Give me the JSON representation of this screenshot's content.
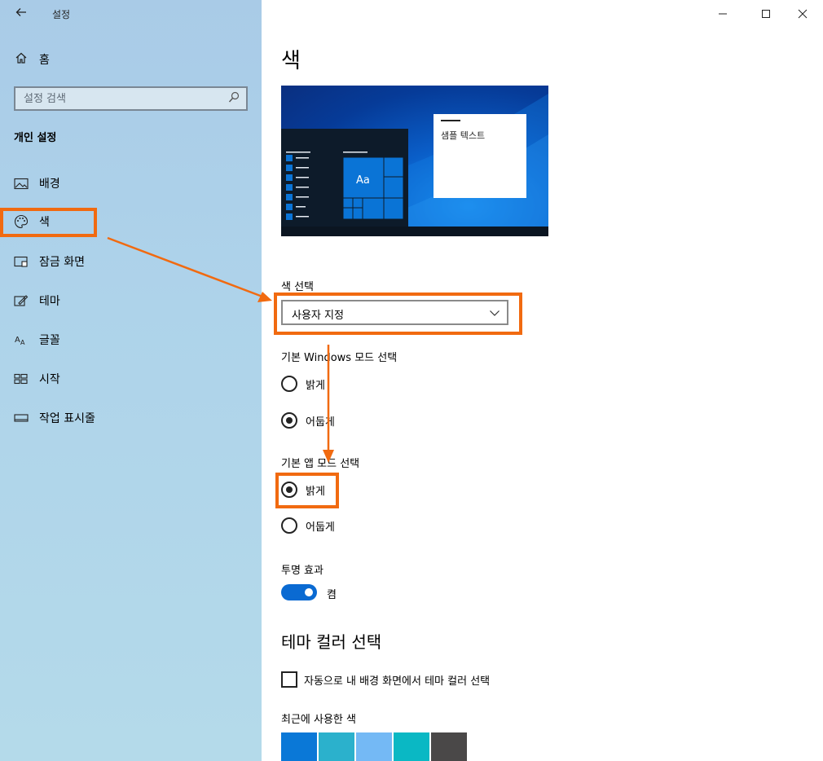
{
  "window": {
    "title": "설정"
  },
  "sidebar": {
    "home_label": "홈",
    "search_placeholder": "설정 검색",
    "section_heading": "개인 설정",
    "items": [
      {
        "label": "배경",
        "icon": "image-icon"
      },
      {
        "label": "색",
        "icon": "palette-icon"
      },
      {
        "label": "잠금 화면",
        "icon": "lock-screen-icon"
      },
      {
        "label": "테마",
        "icon": "theme-icon"
      },
      {
        "label": "글꼴",
        "icon": "font-icon"
      },
      {
        "label": "시작",
        "icon": "start-icon"
      },
      {
        "label": "작업 표시줄",
        "icon": "taskbar-icon"
      }
    ],
    "selected_index": 1
  },
  "main": {
    "title": "색",
    "preview": {
      "sample_text": "샘플 텍스트",
      "tile_label": "Aa"
    },
    "color_choice": {
      "label": "색 선택",
      "value": "사용자 지정"
    },
    "windows_mode": {
      "label": "기본 Windows 모드 선택",
      "options": [
        {
          "label": "밝게",
          "selected": false
        },
        {
          "label": "어둡게",
          "selected": true
        }
      ]
    },
    "app_mode": {
      "label": "기본 앱 모드 선택",
      "options": [
        {
          "label": "밝게",
          "selected": true
        },
        {
          "label": "어둡게",
          "selected": false
        }
      ]
    },
    "transparency": {
      "label": "투명 효과",
      "state": "켬",
      "on": true
    },
    "theme_color": {
      "heading": "테마 컬러 선택",
      "auto_checkbox": "자동으로 내 배경 화면에서 테마 컬러 선택",
      "auto_checked": false,
      "recent_label": "최근에 사용한 색",
      "recent_colors": [
        "#0a78d7",
        "#2bb1cc",
        "#74b9f5",
        "#0ab8c4",
        "#4a4848"
      ]
    }
  },
  "colors": {
    "accent": "#0a6ad2",
    "highlight": "#f16a10"
  }
}
